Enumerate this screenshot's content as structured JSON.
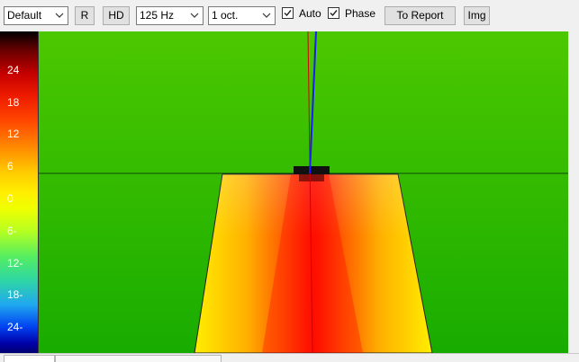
{
  "toolbar": {
    "preset_select": {
      "value": "Default"
    },
    "r_button": "R",
    "hd_button": "HD",
    "frequency_select": {
      "value": "125 Hz"
    },
    "bandwidth_select": {
      "value": "1 oct."
    },
    "auto_checkbox": {
      "label": "Auto",
      "checked": true
    },
    "phase_checkbox": {
      "label": "Phase",
      "checked": true
    },
    "to_report_button": "To Report",
    "img_button": "Img"
  },
  "color_scale": {
    "ticks": [
      "24",
      "18",
      "12",
      "6",
      "0",
      "6-",
      "12-",
      "18-",
      "24-"
    ]
  },
  "colors": {
    "field_top": "#4cc800",
    "field_bottom": "#18ac00",
    "hot": "#ff1800",
    "warm": "#ffee00",
    "beam_axis_blue": "#1a1aff",
    "beam_axis_red": "#d00000",
    "speaker": "#111111"
  },
  "icons": {
    "dropdown": "chevron-down-icon",
    "checkbox": "checkmark-icon"
  }
}
